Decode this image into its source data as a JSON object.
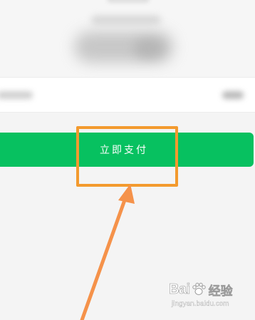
{
  "payment": {
    "pay_button_label": "立即支付",
    "accent_color": "#07c160"
  },
  "annotation": {
    "highlight_color": "#f39a2e",
    "pointer": "arrow-icon"
  },
  "watermark": {
    "brand_left": "Bai",
    "brand_right": "经验",
    "brand_icon": "paw-icon",
    "url": "jingyan.baidu.com"
  }
}
